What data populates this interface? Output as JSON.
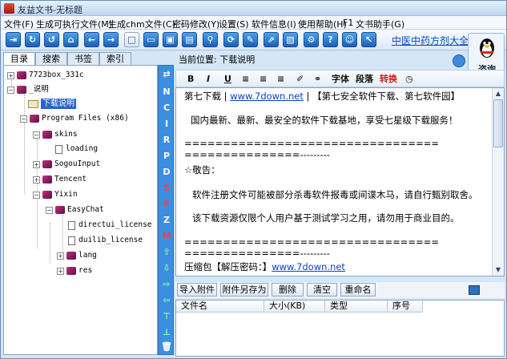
{
  "window": {
    "title": "友益文书-无标题"
  },
  "menu": [
    "文件(F)",
    "生成可执行文件(M)",
    "生成chm文件(C)",
    "密码修改(Y)",
    "设置(S)",
    "软件信息(I)",
    "使用帮助(H)",
    "F1",
    "文书助手(G)"
  ],
  "toolbar": {
    "link_text": "中医中药方剂大全"
  },
  "qq": {
    "label": "咨询"
  },
  "left_tabs": [
    "目录",
    "搜索",
    "书签",
    "索引"
  ],
  "tree": [
    "7723box_331c",
    "_说明",
    "下载说明",
    "Program Files (x86)",
    "skins",
    "loading",
    "SogouInput",
    "Tencent",
    "Yixin",
    "EasyChat",
    "directui_license",
    "duilib_license",
    "lang",
    "res"
  ],
  "side_tools": [
    "N",
    "C",
    "I",
    "R",
    "P",
    "D",
    "S",
    "F",
    "Z",
    "M"
  ],
  "editor": {
    "path_label": "当前位置: 下载说明",
    "format_buttons": [
      "B",
      "I",
      "U",
      "字体",
      "段落",
      "转换"
    ],
    "line1_a": "第七下载 | ",
    "line1_link": "www.7down.net",
    "line1_b": " | 【第七安全软件下载、第七软件园】",
    "line2": "国内最新、最新、最安全的软件下载基地，享受七星级下载服务！",
    "sep1": "=================================",
    "sep2": "===============---------",
    "notice": "☆敬告：",
    "line3": "软件注册文件可能被部分杀毒软件报毒或间谍木马，请自行甄别取舍。",
    "line4": "该下载资源仅限个人用户基于测试学习之用，请勿用于商业目的。",
    "sep3": "=================================",
    "sep4": "===============---------",
    "line5_a": "压缩包【解压密码：】",
    "line5_link": "www.7down.net"
  },
  "attachments": {
    "buttons": [
      "导入附件",
      "附件另存为",
      "删除",
      "清空",
      "重命名"
    ],
    "columns": [
      "文件名",
      "大小(KB)",
      "类型",
      "序号"
    ]
  }
}
